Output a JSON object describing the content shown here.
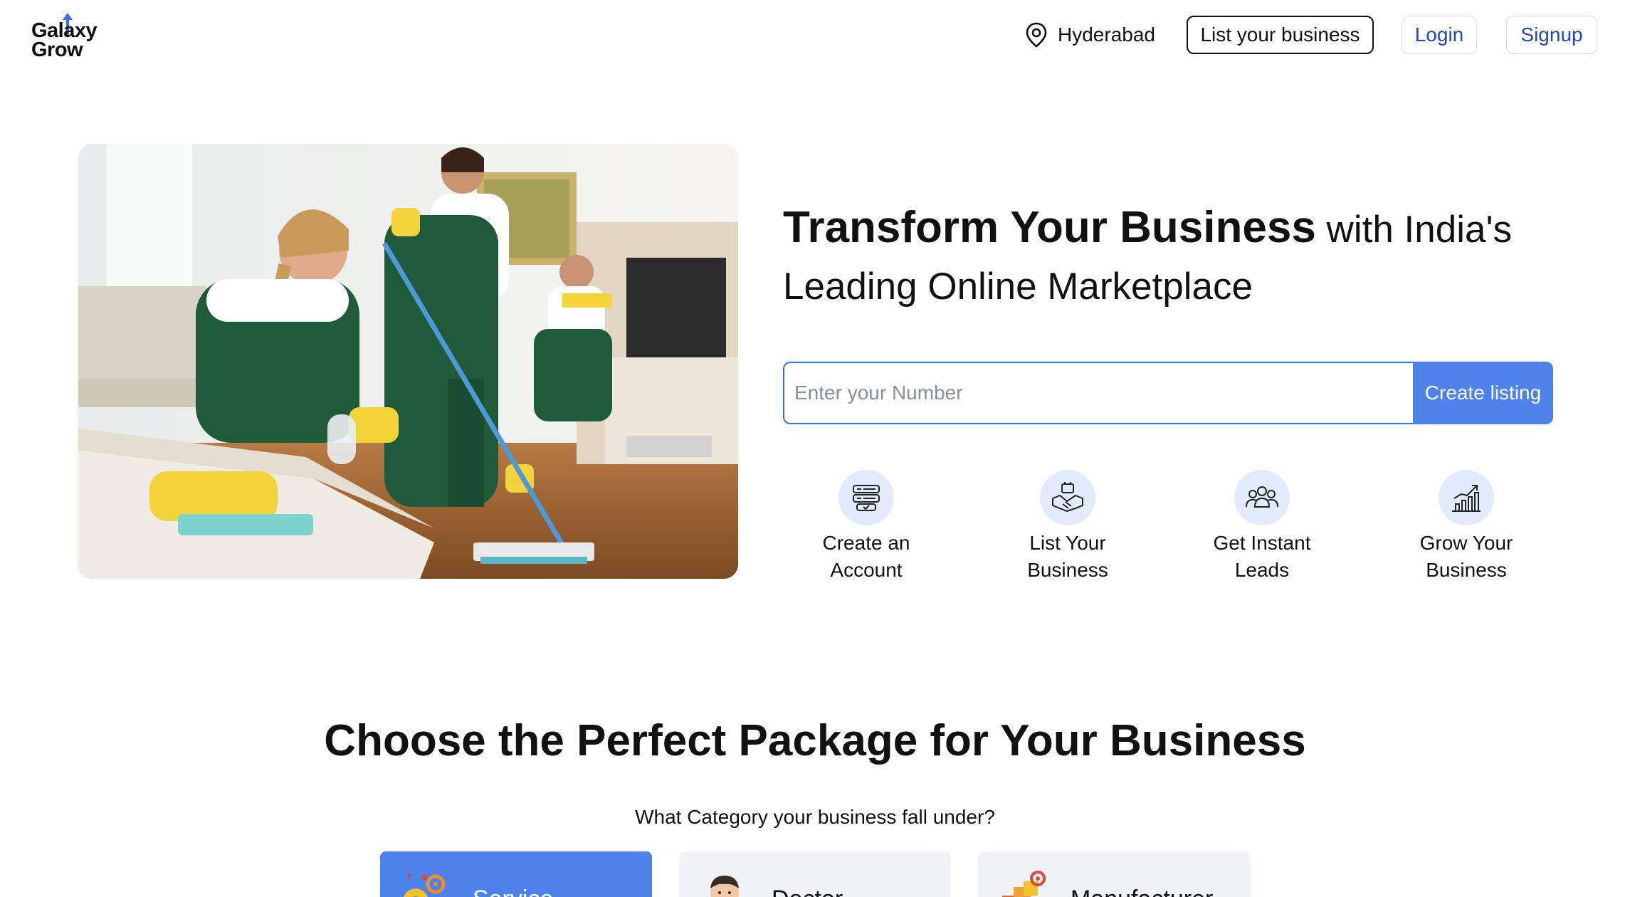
{
  "brand": {
    "logo_line1": "Galaxy",
    "logo_line2": "Grow",
    "accent_color": "#4d82ea",
    "link_color": "#2446b8"
  },
  "header": {
    "location_icon": "location-pin-icon",
    "location": "Hyderabad",
    "list_business_label": "List your business",
    "login_label": "Login",
    "signup_label": "Signup"
  },
  "hero": {
    "image": "cleaning-team-photo",
    "carousel_total": 4,
    "carousel_active": 1,
    "headline_bold": "Transform Your Business",
    "headline_rest": " with India's Leading Online Marketplace",
    "input_placeholder": "Enter your Number",
    "input_value": "",
    "create_label": "Create listing",
    "steps": [
      {
        "icon": "account-card-icon",
        "label_line1": "Create an",
        "label_line2": "Account"
      },
      {
        "icon": "handshake-briefcase-icon",
        "label_line1": "List Your",
        "label_line2": "Business"
      },
      {
        "icon": "people-group-icon",
        "label_line1": "Get Instant",
        "label_line2": "Leads"
      },
      {
        "icon": "growth-chart-icon",
        "label_line1": "Grow Your",
        "label_line2": "Business"
      }
    ]
  },
  "packages": {
    "title": "Choose the Perfect Package for Your Business",
    "subtitle": "What Category your business fall under?",
    "categories": [
      {
        "label": "Service",
        "icon": "service-gears-icon",
        "selected": true
      },
      {
        "label": "Doctor",
        "icon": "doctor-avatar-icon",
        "selected": false
      },
      {
        "label": "Manufacturer",
        "icon": "manufacturer-boxes-icon",
        "selected": false
      }
    ]
  }
}
